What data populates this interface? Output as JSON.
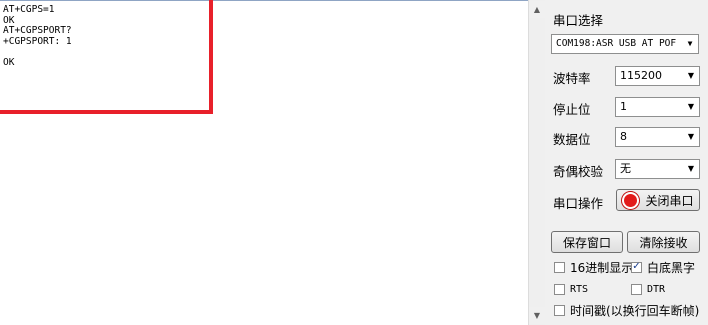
{
  "terminal": {
    "lines": [
      "AT+CGPS=1",
      "OK",
      "AT+CGPSPORT?",
      "+CGPSPORT: 1",
      "",
      "OK"
    ]
  },
  "panel": {
    "port_select_label": "串口选择",
    "port_value": "COM198:ASR USB AT POF",
    "baud_label": "波特率",
    "baud_value": "115200",
    "stop_label": "停止位",
    "stop_value": "1",
    "data_label": "数据位",
    "data_value": "8",
    "parity_label": "奇偶校验",
    "parity_value": "无",
    "port_op_label": "串口操作",
    "close_port_button": "关闭串口",
    "save_window_button": "保存窗口",
    "clear_receive_button": "清除接收",
    "hex_display_label": "16进制显示",
    "hex_display_checked": false,
    "white_bg_label": "白底黑字",
    "white_bg_checked": true,
    "rts_label": "RTS",
    "rts_checked": false,
    "dtr_label": "DTR",
    "dtr_checked": false,
    "timestamp_label": "时间戳(以换行回车断帧)",
    "timestamp_checked": false
  },
  "colors": {
    "highlight": "#e8202a",
    "record_icon": "#e21b1b"
  }
}
